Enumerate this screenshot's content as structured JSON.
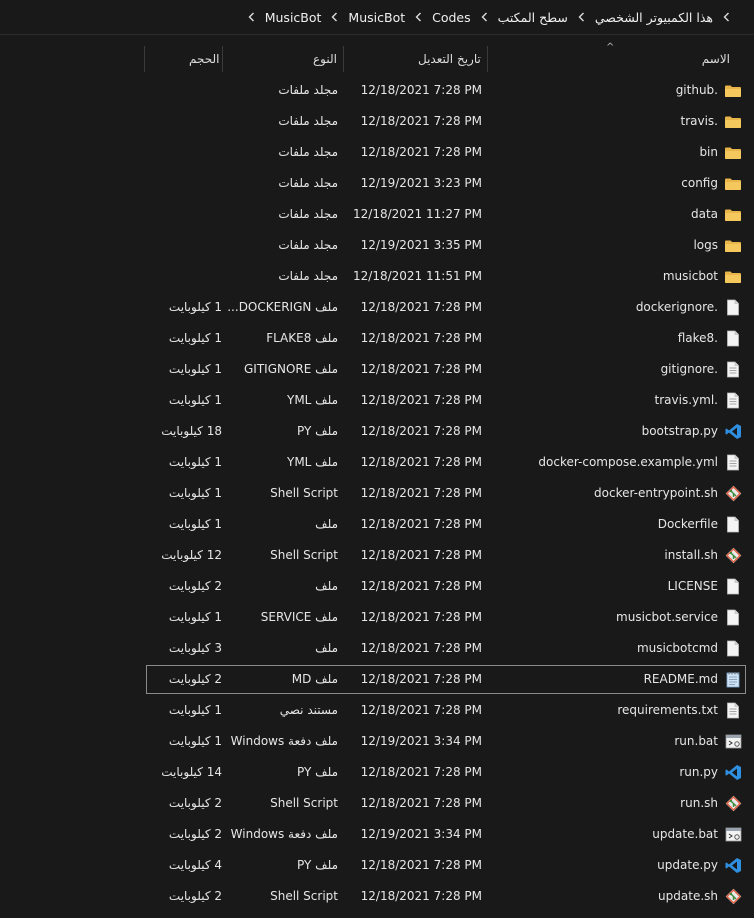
{
  "breadcrumb": [
    "هذا الكمبيوتر الشخصي",
    "سطح المكتب",
    "Codes",
    "MusicBot",
    "MusicBot"
  ],
  "columns": {
    "name": "الاسم",
    "date": "تاريخ التعديل",
    "type": "النوع",
    "size": "الحجم"
  },
  "colors": {
    "folder": "#e8b54a",
    "vscode": "#2f8fe0",
    "gitsh": "#e05a3a"
  },
  "files": [
    {
      "name": ".github",
      "date": "12/18/2021 7:28 PM",
      "type": "مجلد ملفات",
      "size": "",
      "icon": "folder-icon"
    },
    {
      "name": ".travis",
      "date": "12/18/2021 7:28 PM",
      "type": "مجلد ملفات",
      "size": "",
      "icon": "folder-icon"
    },
    {
      "name": "bin",
      "date": "12/18/2021 7:28 PM",
      "type": "مجلد ملفات",
      "size": "",
      "icon": "folder-icon"
    },
    {
      "name": "config",
      "date": "12/19/2021 3:23 PM",
      "type": "مجلد ملفات",
      "size": "",
      "icon": "folder-icon"
    },
    {
      "name": "data",
      "date": "12/18/2021 11:27 PM",
      "type": "مجلد ملفات",
      "size": "",
      "icon": "folder-icon"
    },
    {
      "name": "logs",
      "date": "12/19/2021 3:35 PM",
      "type": "مجلد ملفات",
      "size": "",
      "icon": "folder-icon"
    },
    {
      "name": "musicbot",
      "date": "12/18/2021 11:51 PM",
      "type": "مجلد ملفات",
      "size": "",
      "icon": "folder-icon"
    },
    {
      "name": ".dockerignore",
      "date": "12/18/2021 7:28 PM",
      "type": "ملف DOCKERIGN...",
      "size": "1 كيلوبايت",
      "icon": "file-icon"
    },
    {
      "name": ".flake8",
      "date": "12/18/2021 7:28 PM",
      "type": "ملف FLAKE8",
      "size": "1 كيلوبايت",
      "icon": "file-icon"
    },
    {
      "name": ".gitignore",
      "date": "12/18/2021 7:28 PM",
      "type": "ملف GITIGNORE",
      "size": "1 كيلوبايت",
      "icon": "text-file-icon"
    },
    {
      "name": ".travis.yml",
      "date": "12/18/2021 7:28 PM",
      "type": "ملف YML",
      "size": "1 كيلوبايت",
      "icon": "text-file-icon"
    },
    {
      "name": "bootstrap.py",
      "date": "12/18/2021 7:28 PM",
      "type": "ملف PY",
      "size": "18 كيلوبايت",
      "icon": "vscode-icon"
    },
    {
      "name": "docker-compose.example.yml",
      "date": "12/18/2021 7:28 PM",
      "type": "ملف YML",
      "size": "1 كيلوبايت",
      "icon": "text-file-icon"
    },
    {
      "name": "docker-entrypoint.sh",
      "date": "12/18/2021 7:28 PM",
      "type": "Shell Script",
      "size": "1 كيلوبايت",
      "icon": "git-bash-icon"
    },
    {
      "name": "Dockerfile",
      "date": "12/18/2021 7:28 PM",
      "type": "ملف",
      "size": "1 كيلوبايت",
      "icon": "file-icon"
    },
    {
      "name": "install.sh",
      "date": "12/18/2021 7:28 PM",
      "type": "Shell Script",
      "size": "12 كيلوبايت",
      "icon": "git-bash-icon"
    },
    {
      "name": "LICENSE",
      "date": "12/18/2021 7:28 PM",
      "type": "ملف",
      "size": "2 كيلوبايت",
      "icon": "file-icon"
    },
    {
      "name": "musicbot.service",
      "date": "12/18/2021 7:28 PM",
      "type": "ملف SERVICE",
      "size": "1 كيلوبايت",
      "icon": "file-icon"
    },
    {
      "name": "musicbotcmd",
      "date": "12/18/2021 7:28 PM",
      "type": "ملف",
      "size": "3 كيلوبايت",
      "icon": "file-icon"
    },
    {
      "name": "README.md",
      "date": "12/18/2021 7:28 PM",
      "type": "ملف MD",
      "size": "2 كيلوبايت",
      "icon": "notepad-icon",
      "selected": true
    },
    {
      "name": "requirements.txt",
      "date": "12/18/2021 7:28 PM",
      "type": "مستند نصي",
      "size": "1 كيلوبايت",
      "icon": "text-file-icon"
    },
    {
      "name": "run.bat",
      "date": "12/19/2021 3:34 PM",
      "type": "ملف دفعة Windows",
      "size": "1 كيلوبايت",
      "icon": "batch-file-icon"
    },
    {
      "name": "run.py",
      "date": "12/18/2021 7:28 PM",
      "type": "ملف PY",
      "size": "14 كيلوبايت",
      "icon": "vscode-icon"
    },
    {
      "name": "run.sh",
      "date": "12/18/2021 7:28 PM",
      "type": "Shell Script",
      "size": "2 كيلوبايت",
      "icon": "git-bash-icon"
    },
    {
      "name": "update.bat",
      "date": "12/19/2021 3:34 PM",
      "type": "ملف دفعة Windows",
      "size": "2 كيلوبايت",
      "icon": "batch-file-icon"
    },
    {
      "name": "update.py",
      "date": "12/18/2021 7:28 PM",
      "type": "ملف PY",
      "size": "4 كيلوبايت",
      "icon": "vscode-icon"
    },
    {
      "name": "update.sh",
      "date": "12/18/2021 7:28 PM",
      "type": "Shell Script",
      "size": "2 كيلوبايت",
      "icon": "git-bash-icon"
    }
  ]
}
